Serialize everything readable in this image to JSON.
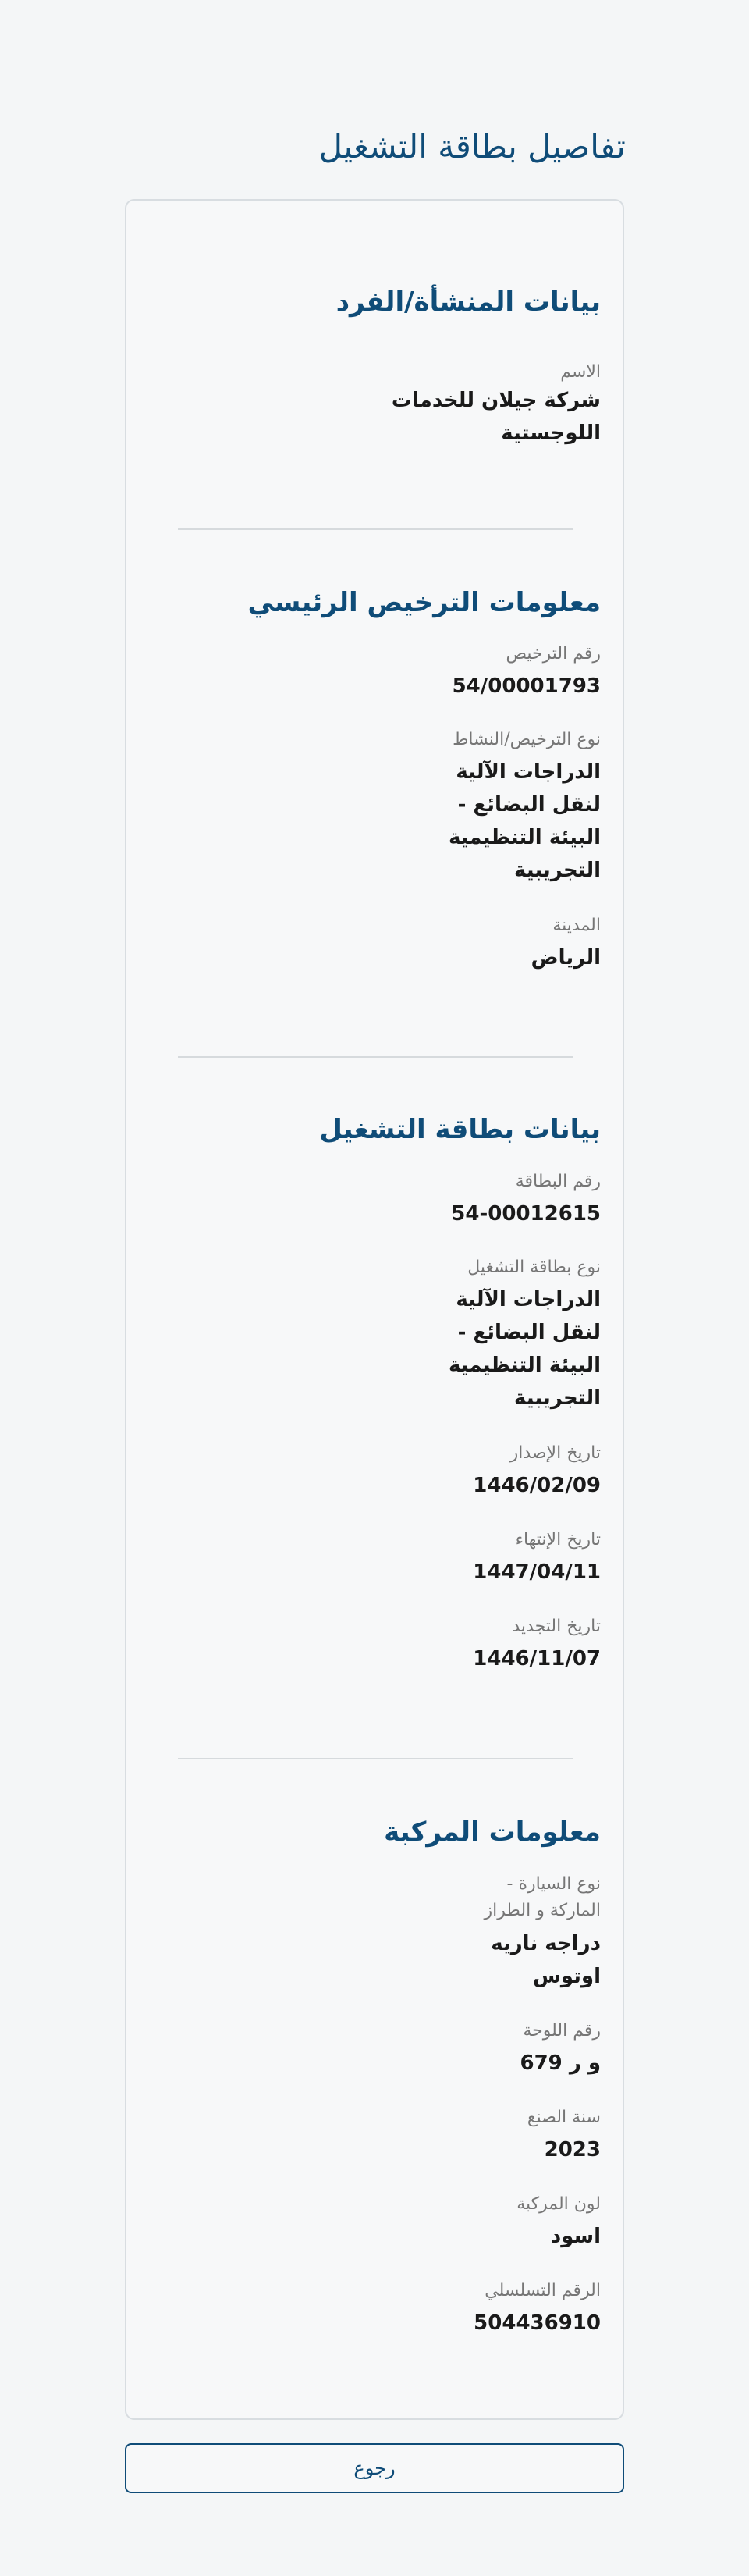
{
  "page": {
    "title": "تفاصيل بطاقة التشغيل",
    "back_button_label": "رجوع"
  },
  "establishment": {
    "title": "بيانات المنشأة/الفرد",
    "name_label": "الاسم",
    "name_value_line1": "شركة جيلان للخدمات",
    "name_value_line2": "اللوجستية"
  },
  "license": {
    "title": "معلومات الترخيص الرئيسي",
    "number_label": "رقم الترخيص",
    "number_value": "54/00001793",
    "type_label": "نوع الترخيص/النشاط",
    "type_value_lines": [
      "الدراجات الآلية",
      "لنقل البضائع -",
      "البيئة التنظيمية",
      "التجريبية"
    ],
    "city_label": "المدينة",
    "city_value": "الرياض"
  },
  "card": {
    "title": "بيانات بطاقة التشغيل",
    "number_label": "رقم البطاقة",
    "number_value": "54-00012615",
    "type_label": "نوع بطاقة التشغيل",
    "type_value_lines": [
      "الدراجات الآلية",
      "لنقل البضائع -",
      "البيئة التنظيمية",
      "التجريبية"
    ],
    "issue_date_label": "تاريخ الإصدار",
    "issue_date_value": "1446/02/09",
    "expiry_date_label": "تاريخ الإنتهاء",
    "expiry_date_value": "1447/04/11",
    "renewal_date_label": "تاريخ التجديد",
    "renewal_date_value": "1446/11/07"
  },
  "vehicle": {
    "title": "معلومات المركبة",
    "type_label_line1": "نوع السيارة -",
    "type_label_line2": "الماركة و الطراز",
    "type_value_line1": "دراجه ناريه",
    "type_value_line2": "اوتوس",
    "plate_label": "رقم اللوحة",
    "plate_value": "و ر 679",
    "year_label": "سنة الصنع",
    "year_value": "2023",
    "color_label": "لون المركبة",
    "color_value": "اسود",
    "serial_label": "الرقم التسلسلي",
    "serial_value": "504436910"
  }
}
